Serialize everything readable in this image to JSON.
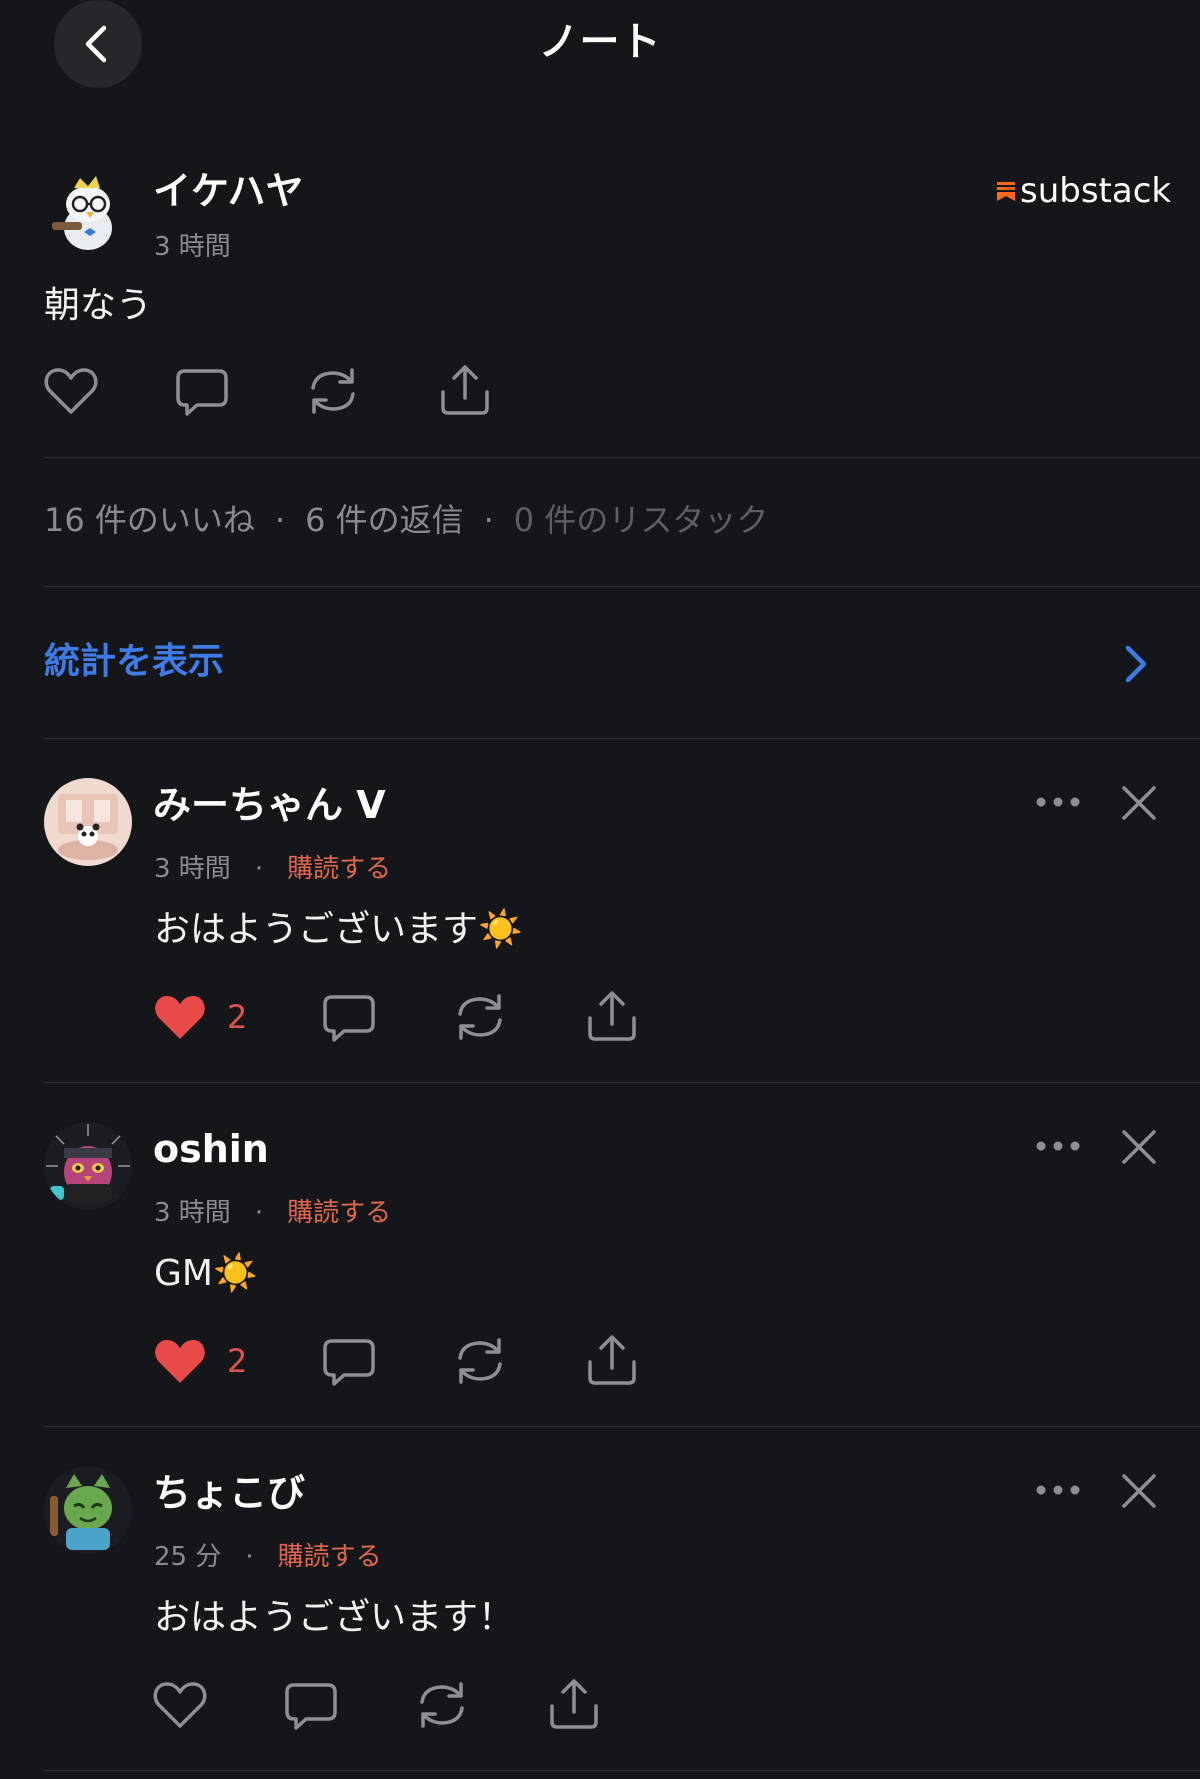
{
  "header": {
    "title": "ノート"
  },
  "post": {
    "author": "イケハヤ",
    "time": "3 時間",
    "text": "朝なう",
    "brand": "substack"
  },
  "stats": {
    "likes": "16 件のいいね",
    "replies": "6 件の返信",
    "restacks": "0 件のリスタック",
    "separator": "·"
  },
  "view_stats": {
    "label": "統計を表示"
  },
  "comments": [
    {
      "author": "みーちゃん V",
      "time": "3 時間",
      "subscribe": "購読する",
      "text": "おはようございます☀️",
      "likes": "2",
      "liked": true
    },
    {
      "author": "oshin",
      "time": "3 時間",
      "subscribe": "購読する",
      "text": "GM☀️",
      "likes": "2",
      "liked": true
    },
    {
      "author": "ちょこび",
      "time": "25 分",
      "subscribe": "購読する",
      "text": "おはようございます！",
      "likes": "",
      "liked": false
    }
  ],
  "colors": {
    "background": "#151619",
    "link": "#3d7be6",
    "subscribe": "#e0674b",
    "heart": "#e84a4a",
    "substack": "#ff6719"
  },
  "icons": [
    "back-chevron-icon",
    "heart-icon",
    "comment-icon",
    "restack-icon",
    "share-icon",
    "more-icon",
    "close-icon",
    "chevron-right-icon",
    "substack-logo-icon"
  ]
}
